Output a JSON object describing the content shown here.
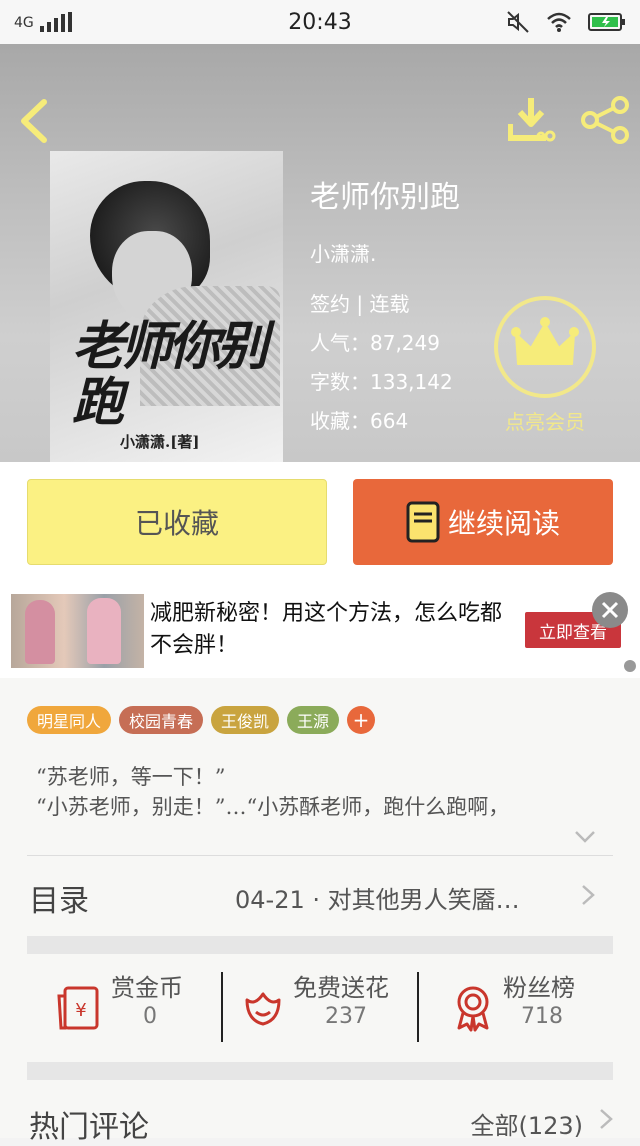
{
  "status_bar": {
    "network": "4G",
    "time": "20:43"
  },
  "book": {
    "title": "老师你别跑",
    "author": "小潇潇.",
    "status": "签约 | 连载",
    "popularity_label": "人气：87,249",
    "words_label": "字数：133,142",
    "favorites_label": "收藏：664",
    "cover_title": "老师你别跑",
    "cover_author": "小潇潇.[著]"
  },
  "member": {
    "label": "点亮会员"
  },
  "actions": {
    "favorited": "已收藏",
    "continue_reading": "继续阅读"
  },
  "ad": {
    "text": "减肥新秘密！用这个方法，怎么吃都不会胖！",
    "cta": "立即查看"
  },
  "tags": [
    {
      "label": "明星同人",
      "color": "#f0a73c"
    },
    {
      "label": "校园青春",
      "color": "#c66e55"
    },
    {
      "label": "王俊凯",
      "color": "#c9a43f"
    },
    {
      "label": "王源",
      "color": "#8bab5a"
    }
  ],
  "summary": {
    "line1": "“苏老师，等一下！”",
    "line2": "“小苏老师，别走！”…“小苏酥老师，跑什么跑啊，"
  },
  "toc": {
    "label": "目录",
    "latest": "04-21 · 对其他男人笑靥…"
  },
  "stats": {
    "coins": {
      "label": "赏金币",
      "value": "0"
    },
    "flowers": {
      "label": "免费送花",
      "value": "237"
    },
    "fans": {
      "label": "粉丝榜",
      "value": "718"
    }
  },
  "comments": {
    "label": "热门评论",
    "all": "全部(123)"
  },
  "colors": {
    "accent_orange": "#e8683b",
    "fav_yellow": "#fbf183",
    "member_gold": "#f2e88a",
    "icon_red": "#c9362c"
  }
}
